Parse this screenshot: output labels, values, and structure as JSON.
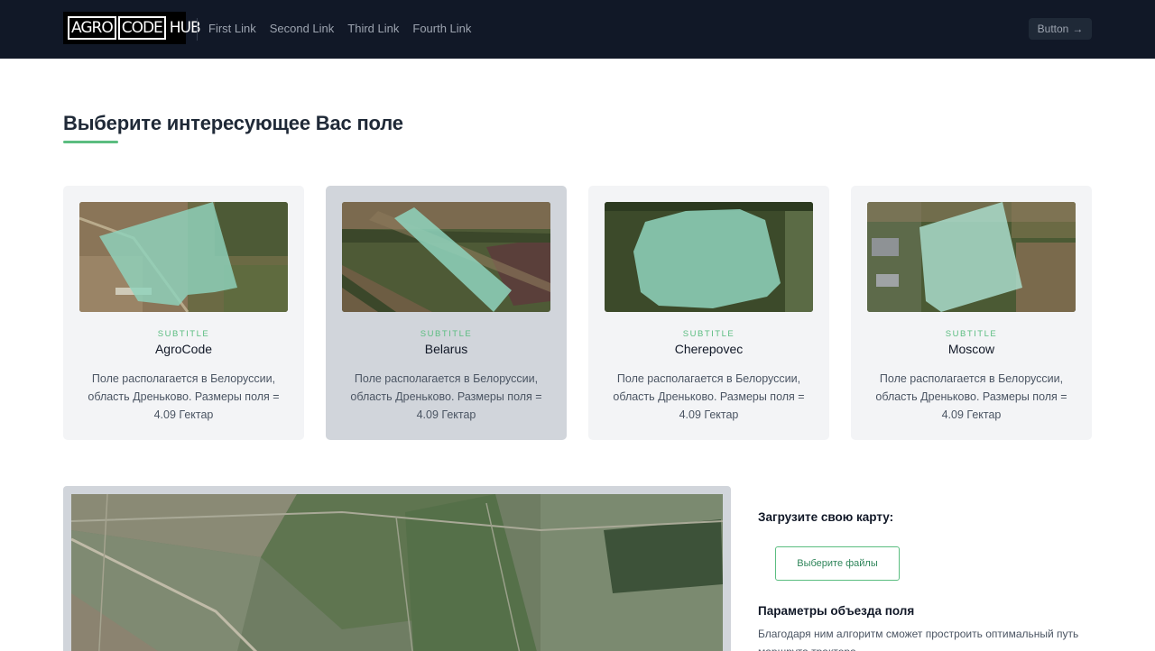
{
  "header": {
    "logo": {
      "part1": "AGRO",
      "part2": "CODE",
      "part3": "HUB"
    },
    "nav": [
      "First Link",
      "Second Link",
      "Third Link",
      "Fourth Link"
    ],
    "button_label": "Button",
    "button_icon": "arrow-right-icon",
    "button_glyph": "→"
  },
  "main": {
    "title": "Выберите интересующее Вас поле",
    "accent_color": "#5bbd80"
  },
  "cards": [
    {
      "subtitle": "SUBTITLE",
      "name": "AgroCode",
      "description": "Поле располагается в Белоруссии, область Дреньково. Размеры поля = 4.09 Гектар"
    },
    {
      "subtitle": "SUBTITLE",
      "name": "Belarus",
      "description": "Поле располагается в Белоруссии, область Дреньково. Размеры поля = 4.09 Гектар",
      "selected": true
    },
    {
      "subtitle": "SUBTITLE",
      "name": "Cherepovec",
      "description": "Поле располагается в Белоруссии, область Дреньково. Размеры поля = 4.09 Гектар"
    },
    {
      "subtitle": "SUBTITLE",
      "name": "Moscow",
      "description": "Поле располагается в Белоруссии, область Дреньково. Размеры поля = 4.09 Гектар"
    }
  ],
  "upload": {
    "label": "Загрузите свою карту:",
    "button_label": "Выберите файлы"
  },
  "params": {
    "title": "Параметры объезда поля",
    "description": "Благодаря ним алгоритм сможет простроить оптимальный путь маршрута трактора"
  }
}
